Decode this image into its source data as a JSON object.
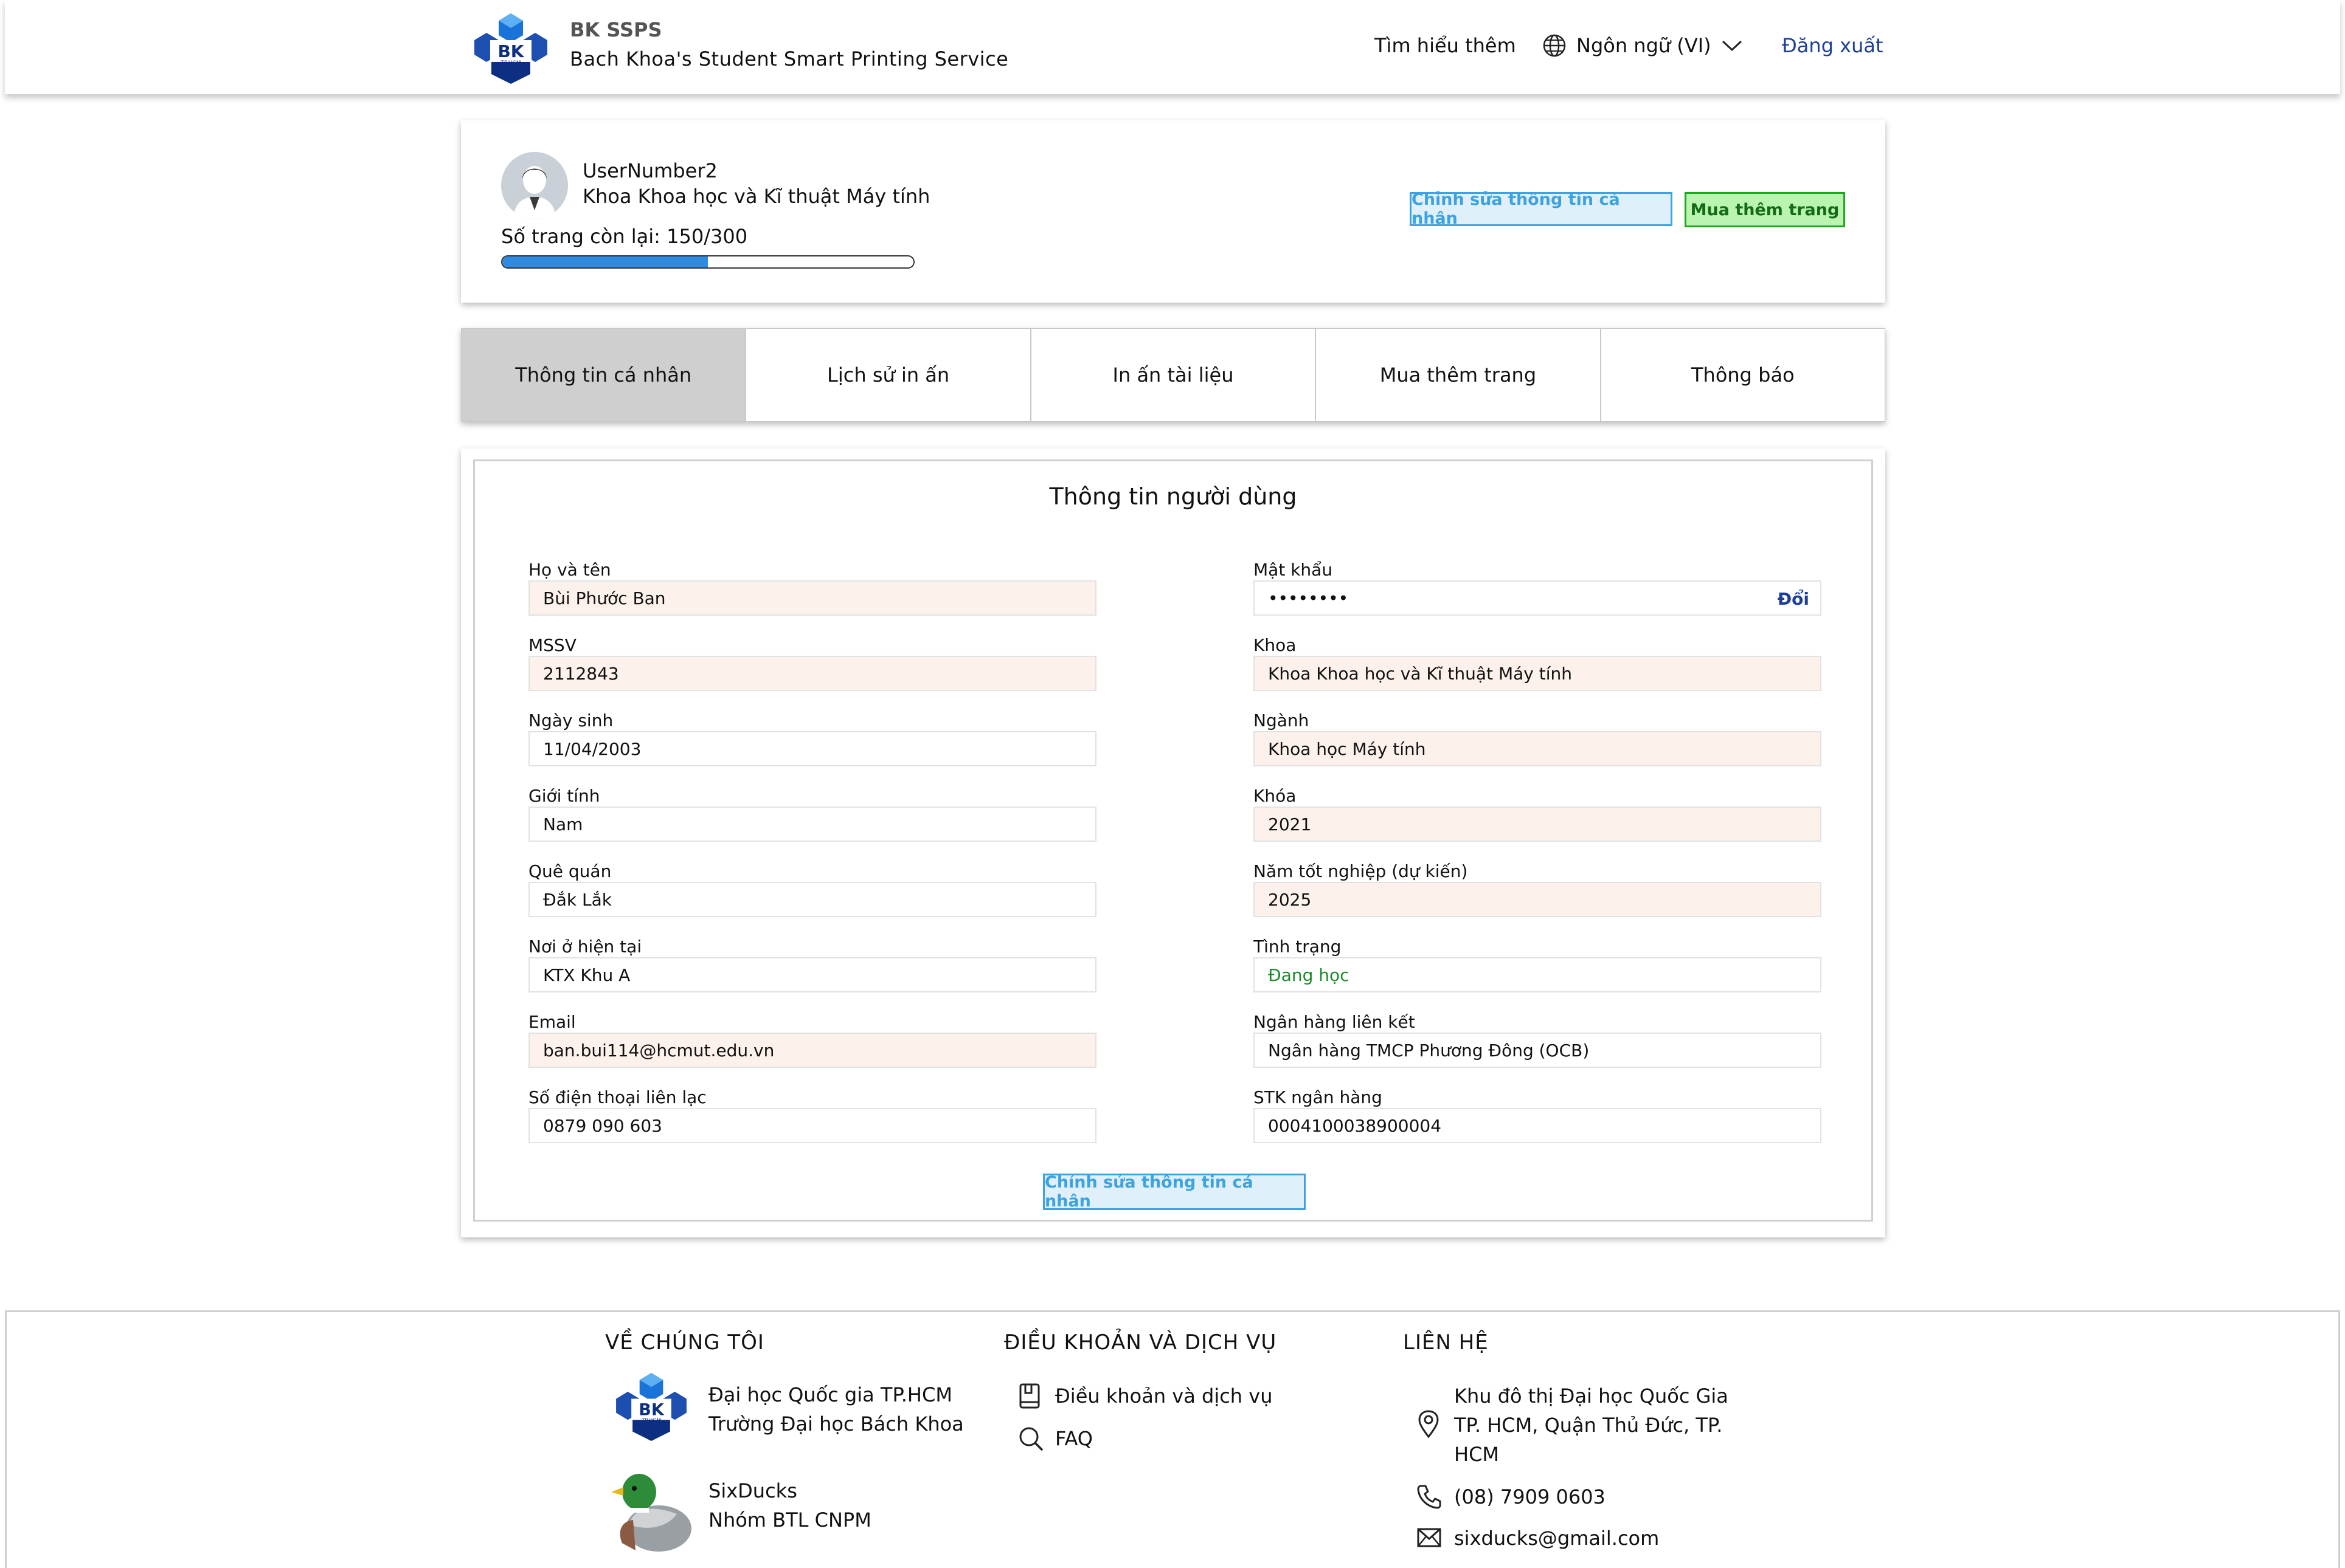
{
  "header": {
    "brand_title": "BK SSPS",
    "brand_subtitle": "Bach Khoa's Student Smart Printing Service",
    "learn_more": "Tìm hiểu thêm",
    "language": "Ngôn ngữ (VI)",
    "logout": "Đăng xuất"
  },
  "profile": {
    "username": "UserNumber2",
    "faculty": "Khoa Khoa học và Kĩ thuật Máy tính",
    "pages_label": "Số trang còn lại:",
    "pages_value": "150/300",
    "pages_fraction": 0.5,
    "edit_button": "Chỉnh sửa thông tin cá nhân",
    "buy_button": "Mua thêm trang"
  },
  "tabs": [
    {
      "label": "Thông tin cá nhân",
      "active": true
    },
    {
      "label": "Lịch sử in ấn",
      "active": false
    },
    {
      "label": "In ấn tài liệu",
      "active": false
    },
    {
      "label": "Mua thêm trang",
      "active": false
    },
    {
      "label": "Thông báo",
      "active": false
    }
  ],
  "info": {
    "title": "Thông tin người dùng",
    "left": [
      {
        "label": "Họ và tên",
        "value": "Bùi Phước Ban"
      },
      {
        "label": "MSSV",
        "value": "2112843"
      },
      {
        "label": "Ngày sinh",
        "value": "11/04/2003"
      },
      {
        "label": "Giới tính",
        "value": "Nam"
      },
      {
        "label": "Quê quán",
        "value": "Đắk Lắk"
      },
      {
        "label": "Nơi ở hiện tại",
        "value": "KTX Khu A"
      },
      {
        "label": "Email",
        "value": "ban.bui114@hcmut.edu.vn"
      },
      {
        "label": "Số điện thoại liên lạc",
        "value": "0879 090 603"
      }
    ],
    "right": [
      {
        "label": "Mật khẩu",
        "value": "••••••••",
        "action": "Đổi"
      },
      {
        "label": "Khoa",
        "value": "Khoa Khoa học và Kĩ thuật Máy tính"
      },
      {
        "label": "Ngành",
        "value": "Khoa học Máy tính"
      },
      {
        "label": "Khóa",
        "value": "2021"
      },
      {
        "label": "Năm tốt nghiệp (dự kiến)",
        "value": "2025"
      },
      {
        "label": "Tình trạng",
        "value": "Đang học"
      },
      {
        "label": "Ngân hàng liên kết",
        "value": "Ngân hàng TMCP Phương Đông (OCB)"
      },
      {
        "label": "STK ngân hàng",
        "value": "0004100038900004"
      }
    ],
    "edit_button": "Chỉnh sửa thông tin cá nhân"
  },
  "footer": {
    "about_heading": "VỀ CHÚNG TÔI",
    "university_line1": "Đại học Quốc gia TP.HCM",
    "university_line2": "Trường Đại học Bách Khoa",
    "team_line1": "SixDucks",
    "team_line2": "Nhóm BTL CNPM",
    "terms_heading": "ĐIỀU KHOẢN VÀ DỊCH VỤ",
    "terms_link": "Điều khoản và dịch vụ",
    "faq_link": "FAQ",
    "contact_heading": "LIÊN HỆ",
    "address_line1": "Khu đô thị Đại học Quốc Gia",
    "address_line2": "TP. HCM, Quận Thủ Đức, TP.",
    "address_line3": "HCM",
    "phone": "(08) 7909 0603",
    "email": "sixducks@gmail.com"
  },
  "logo_text": "BK",
  "logo_subtext": "TP.HCM",
  "colors": {
    "accent_blue": "#3da3e0",
    "accent_green": "#1fa81f",
    "link_blue": "#1b3f9a",
    "readonly_bg": "#fcf1eb",
    "progress": "#2f8be2",
    "status_green": "#1d8b2a"
  },
  "icons": [
    "bk-logo-icon",
    "globe-icon",
    "chevron-down-icon",
    "avatar-icon",
    "book-icon",
    "search-icon",
    "location-icon",
    "phone-icon",
    "mail-icon",
    "duck-icon"
  ]
}
